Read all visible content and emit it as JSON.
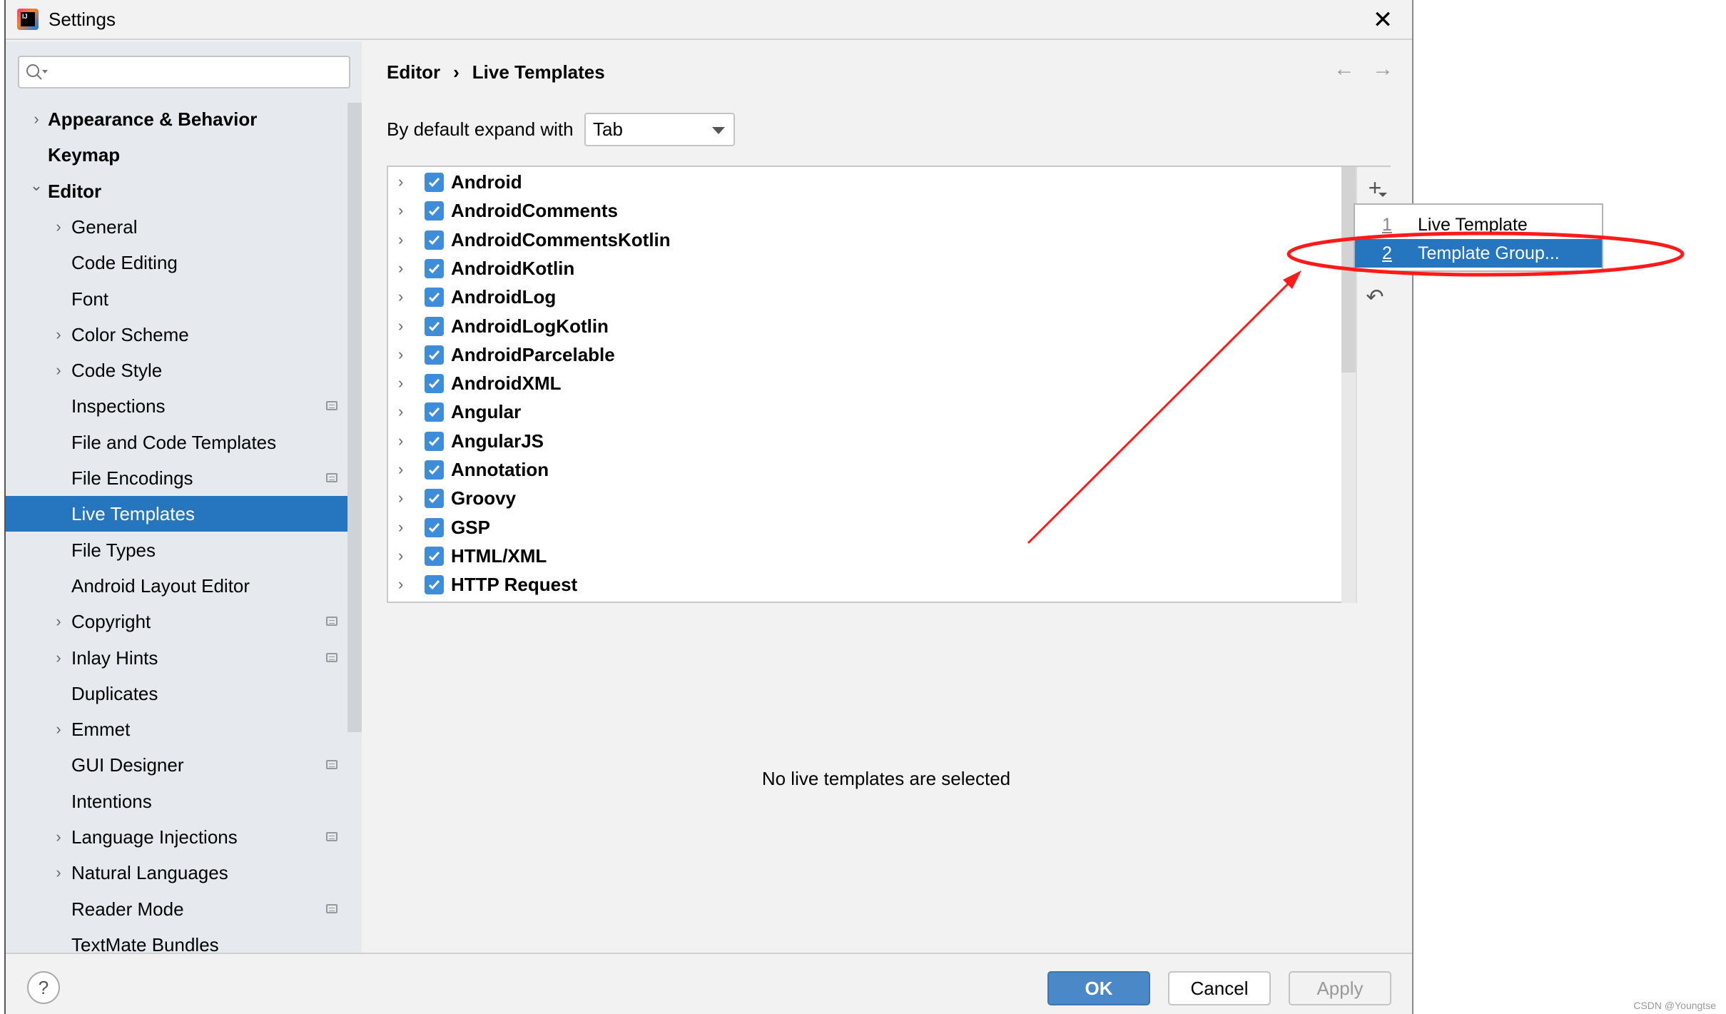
{
  "window": {
    "title": "Settings",
    "close_icon": "close-icon"
  },
  "sidebar": {
    "search": {
      "placeholder": "",
      "value": ""
    },
    "items": [
      {
        "label": "Appearance & Behavior",
        "level": 0,
        "bold": true,
        "expandable": true,
        "expanded": false
      },
      {
        "label": "Keymap",
        "level": 0,
        "bold": true,
        "expandable": false
      },
      {
        "label": "Editor",
        "level": 0,
        "bold": true,
        "expandable": true,
        "expanded": true
      },
      {
        "label": "General",
        "level": 1,
        "expandable": true
      },
      {
        "label": "Code Editing",
        "level": 1
      },
      {
        "label": "Font",
        "level": 1
      },
      {
        "label": "Color Scheme",
        "level": 1,
        "expandable": true
      },
      {
        "label": "Code Style",
        "level": 1,
        "expandable": true
      },
      {
        "label": "Inspections",
        "level": 1,
        "badge": true
      },
      {
        "label": "File and Code Templates",
        "level": 1
      },
      {
        "label": "File Encodings",
        "level": 1,
        "badge": true
      },
      {
        "label": "Live Templates",
        "level": 1,
        "selected": true
      },
      {
        "label": "File Types",
        "level": 1
      },
      {
        "label": "Android Layout Editor",
        "level": 1
      },
      {
        "label": "Copyright",
        "level": 1,
        "expandable": true,
        "badge": true
      },
      {
        "label": "Inlay Hints",
        "level": 1,
        "expandable": true,
        "badge": true
      },
      {
        "label": "Duplicates",
        "level": 1
      },
      {
        "label": "Emmet",
        "level": 1,
        "expandable": true
      },
      {
        "label": "GUI Designer",
        "level": 1,
        "badge": true
      },
      {
        "label": "Intentions",
        "level": 1
      },
      {
        "label": "Language Injections",
        "level": 1,
        "expandable": true,
        "badge": true
      },
      {
        "label": "Natural Languages",
        "level": 1,
        "expandable": true
      },
      {
        "label": "Reader Mode",
        "level": 1,
        "badge": true
      },
      {
        "label": "TextMate Bundles",
        "level": 1
      }
    ]
  },
  "main": {
    "breadcrumb": [
      "Editor",
      "Live Templates"
    ],
    "breadcrumb_sep": "›",
    "nav": {
      "back": "←",
      "forward": "→"
    },
    "expand_label": "By default expand with",
    "expand_value": "Tab",
    "groups": [
      {
        "label": "Android",
        "checked": true
      },
      {
        "label": "AndroidComments",
        "checked": true
      },
      {
        "label": "AndroidCommentsKotlin",
        "checked": true
      },
      {
        "label": "AndroidKotlin",
        "checked": true
      },
      {
        "label": "AndroidLog",
        "checked": true
      },
      {
        "label": "AndroidLogKotlin",
        "checked": true
      },
      {
        "label": "AndroidParcelable",
        "checked": true
      },
      {
        "label": "AndroidXML",
        "checked": true
      },
      {
        "label": "Angular",
        "checked": true
      },
      {
        "label": "AngularJS",
        "checked": true
      },
      {
        "label": "Annotation",
        "checked": true
      },
      {
        "label": "Groovy",
        "checked": true
      },
      {
        "label": "GSP",
        "checked": true
      },
      {
        "label": "HTML/XML",
        "checked": true
      },
      {
        "label": "HTTP Request",
        "checked": true
      }
    ],
    "empty_text": "No live templates are selected",
    "add_menu": [
      {
        "num": "1",
        "label": "Live Template"
      },
      {
        "num": "2",
        "label": "Template Group...",
        "selected": true
      }
    ]
  },
  "footer": {
    "help": "?",
    "ok": "OK",
    "cancel": "Cancel",
    "apply": "Apply"
  },
  "annotation": {
    "color": "#ff1a1a"
  },
  "accent": "#2675bf",
  "watermark": "CSDN @Youngtse"
}
